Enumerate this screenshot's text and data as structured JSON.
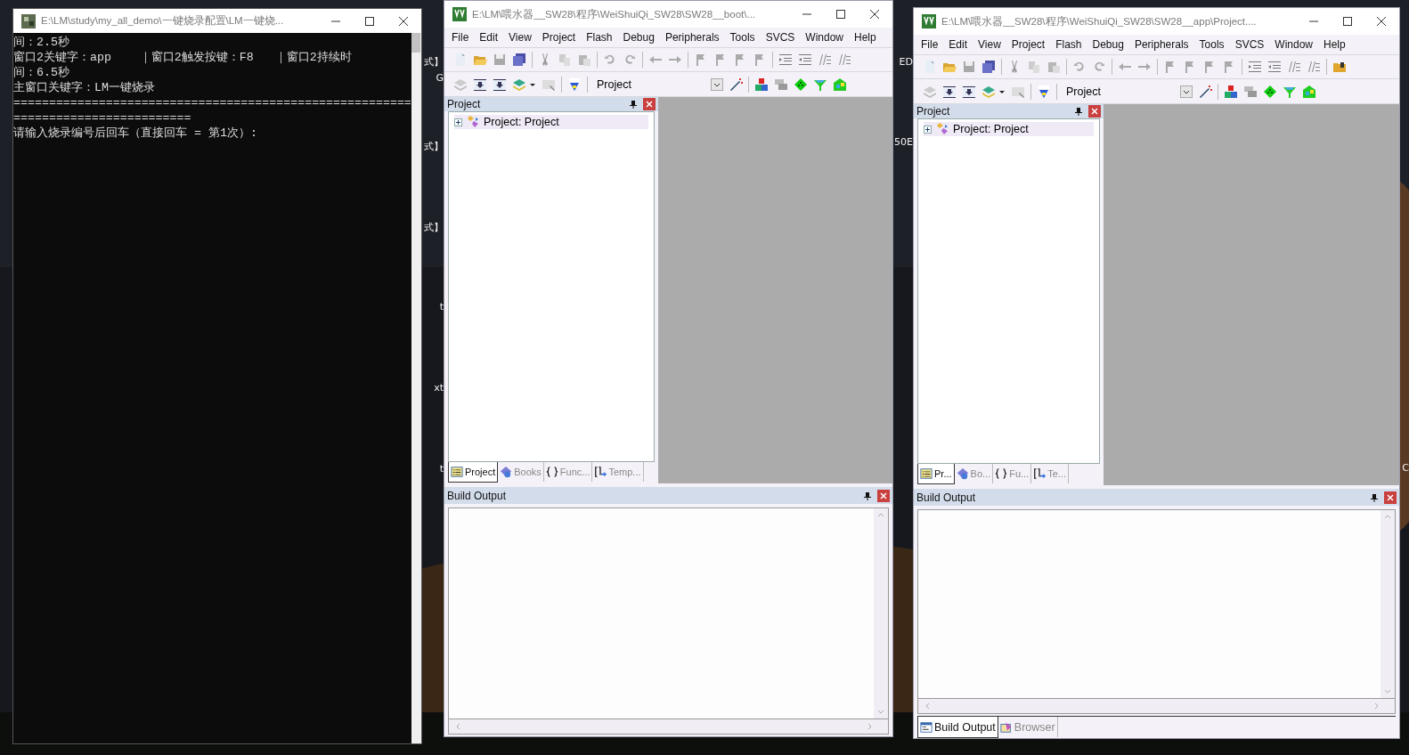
{
  "desktop_labels": [
    "式】",
    "G",
    "式】",
    "式】",
    "t",
    "xt",
    "t",
    "ED",
    "50E",
    "C"
  ],
  "console": {
    "title": "E:\\LM\\study\\my_all_demo\\一键烧录配置\\LM一键烧...",
    "lines": [
      "间：2.5秒",
      "窗口2关键字：app    ｜窗口2触发按键：F8   ｜窗口2持续时",
      "间：6.5秒",
      "主窗口关键字：LM一键烧录",
      "========================================================",
      "=========================",
      "请输入烧录编号后回车（直接回车 = 第1次）:"
    ]
  },
  "keil_windows": [
    {
      "title": "E:\\LM\\喂水器__SW28\\程序\\WeiShuiQi_SW28\\SW28__boot\\...",
      "menu": [
        "File",
        "Edit",
        "View",
        "Project",
        "Flash",
        "Debug",
        "Peripherals",
        "Tools",
        "SVCS",
        "Window",
        "Help"
      ],
      "target": "Project",
      "project_panel": {
        "title": "Project",
        "tree": [
          {
            "label": "Project: Project",
            "expanded": false
          }
        ]
      },
      "panel_tabs": [
        {
          "label": "Project",
          "selected": true
        },
        {
          "label": "Books",
          "selected": false
        },
        {
          "label": "Func...",
          "selected": false
        },
        {
          "label": "Temp...",
          "selected": false
        }
      ],
      "output_panel": {
        "title": "Build Output"
      }
    },
    {
      "title": "E:\\LM\\喂水器__SW28\\程序\\WeiShuiQi_SW28\\SW28__app\\Project....",
      "menu": [
        "File",
        "Edit",
        "View",
        "Project",
        "Flash",
        "Debug",
        "Peripherals",
        "Tools",
        "SVCS",
        "Window",
        "Help"
      ],
      "target": "Project",
      "project_panel": {
        "title": "Project",
        "tree": [
          {
            "label": "Project: Project",
            "expanded": false
          }
        ]
      },
      "panel_tabs": [
        {
          "label": "Pr...",
          "selected": true
        },
        {
          "label": "Bo...",
          "selected": false
        },
        {
          "label": "Fu...",
          "selected": false
        },
        {
          "label": "Te...",
          "selected": false
        }
      ],
      "output_panel": {
        "title": "Build Output",
        "tabs": [
          {
            "label": "Build Output",
            "selected": true
          },
          {
            "label": "Browser",
            "selected": false
          }
        ]
      }
    }
  ]
}
